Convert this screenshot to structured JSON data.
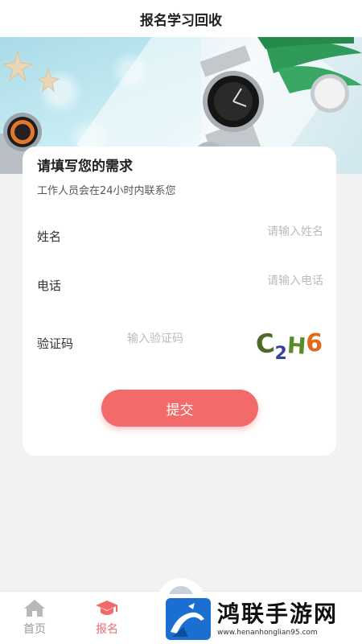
{
  "header": {
    "title": "报名学习回收"
  },
  "form": {
    "title": "请填写您的需求",
    "subtitle": "工作人员会在24小时内联系您",
    "name_label": "姓名",
    "name_placeholder": "请输入姓名",
    "phone_label": "电话",
    "phone_placeholder": "请输入电话",
    "code_label": "验证码",
    "code_placeholder": "输入验证码",
    "captcha_text": "C2H6",
    "submit_label": "提交"
  },
  "tabbar": {
    "items": [
      {
        "label": "首页",
        "icon": "home-icon",
        "active": false
      },
      {
        "label": "报名",
        "icon": "graduation-cap-icon",
        "active": true
      }
    ]
  },
  "watermark": {
    "title": "鸿联手游网",
    "url": "www.henanhonglian95.com"
  },
  "colors": {
    "accent": "#f26a6a",
    "inactive": "#999999"
  }
}
